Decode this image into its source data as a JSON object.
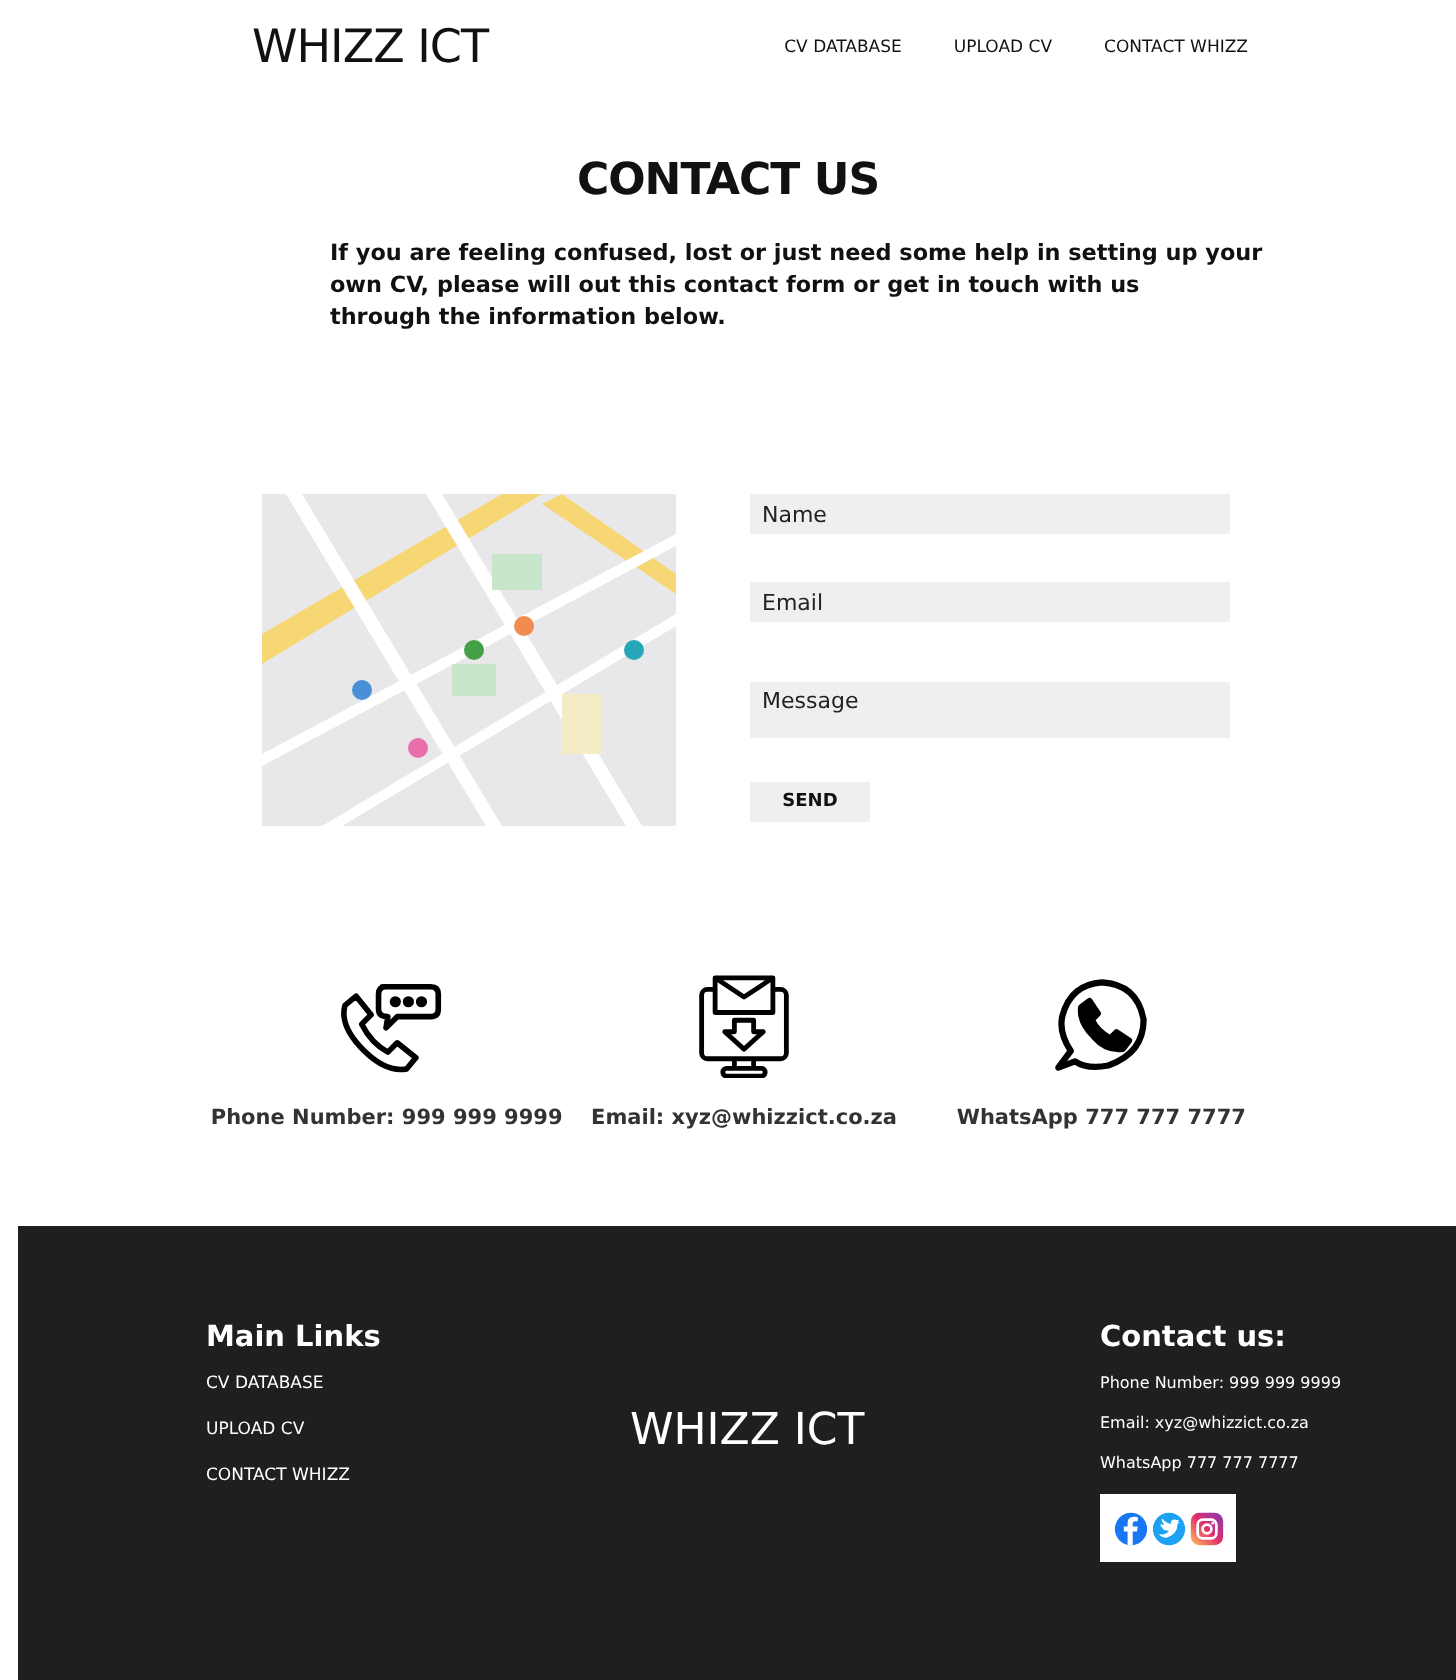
{
  "header": {
    "logo": "WHIZZ ICT",
    "nav": [
      "CV DATABASE",
      "UPLOAD CV",
      "CONTACT WHIZZ"
    ]
  },
  "heading": "CONTACT US",
  "intro": [
    "If you are feeling confused, lost or just need some help in setting up your",
    "own CV, please will out this contact form or get in touch with us",
    "through the information below."
  ],
  "form": {
    "fields": [
      {
        "kind": "line",
        "placeholder": "Name"
      },
      {
        "kind": "line",
        "placeholder": "Email"
      },
      {
        "kind": "area",
        "placeholder": "Message"
      }
    ],
    "button": "SEND"
  },
  "contacts": [
    {
      "kind": "phone",
      "text": "Phone Number: 999 999 9999"
    },
    {
      "kind": "email",
      "text": "Email: xyz@whizzict.co.za"
    },
    {
      "kind": "whatsapp",
      "text": "WhatsApp 777 777 7777"
    }
  ],
  "footer": {
    "links_title": "Main Links",
    "links": [
      "CV DATABASE",
      "UPLOAD CV",
      "CONTACT WHIZZ"
    ],
    "logo": "WHIZZ ICT",
    "contact_title": "Contact us:",
    "contact_lines": [
      "Phone Number: 999 999 9999",
      "Email: xyz@whizzict.co.za",
      "WhatsApp 777 777 7777"
    ],
    "social": [
      {
        "kind": "facebook"
      },
      {
        "kind": "twitter"
      },
      {
        "kind": "instagram"
      }
    ]
  }
}
